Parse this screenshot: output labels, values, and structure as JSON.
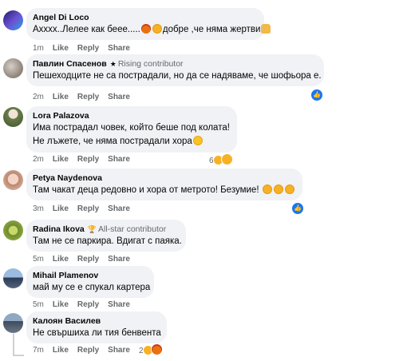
{
  "comments": [
    {
      "name": "Angel Di Loco",
      "text_parts": [
        "Ахххх..Лелее как бееe.....",
        "добре ,че няма жертви"
      ],
      "time": "1m",
      "like": "Like",
      "reply": "Reply",
      "share": "Share",
      "avatar_icon": "avatar-purple-blue"
    },
    {
      "name": "Павлин Спасенов",
      "badge": "Rising contributor",
      "text": "Пешеходците не са пострадали, но да се надяваме, че шофьора е.",
      "time": "2m",
      "like": "Like",
      "reply": "Reply",
      "share": "Share",
      "reaction_icon": "like-icon"
    },
    {
      "name": "Lora Palazova",
      "text_line1": "Има пострадал човек, който беше под колата!",
      "text_line2": "Не лъжете, че няма пострадали хора",
      "time": "2m",
      "like": "Like",
      "reply": "Reply",
      "share": "Share",
      "reaction_count": "6"
    },
    {
      "name": "Petya Naydenova",
      "text": "Там чакат деца редовно и хора от метрото! Безумие!",
      "time": "3m",
      "like": "Like",
      "reply": "Reply",
      "share": "Share",
      "reaction_icon": "like-icon"
    },
    {
      "name": "Radina Ikova",
      "badge": "All-star contributor",
      "text": "Там не се паркира. Вдигат с паяка.",
      "time": "5m",
      "like": "Like",
      "reply": "Reply",
      "share": "Share"
    },
    {
      "name": "Mihail Plamenov",
      "text": "май му се е спукал картера",
      "time": "5m",
      "like": "Like",
      "reply": "Reply",
      "share": "Share"
    },
    {
      "name": "Калоян Василев",
      "text": "Не свършиха ли тия бенвента",
      "time": "7m",
      "like": "Like",
      "reply": "Reply",
      "share": "Share",
      "reaction_count": "2"
    }
  ],
  "colors": {
    "bubble": "#f0f2f5",
    "meta": "#65676b",
    "like_blue": "#1877f2"
  }
}
